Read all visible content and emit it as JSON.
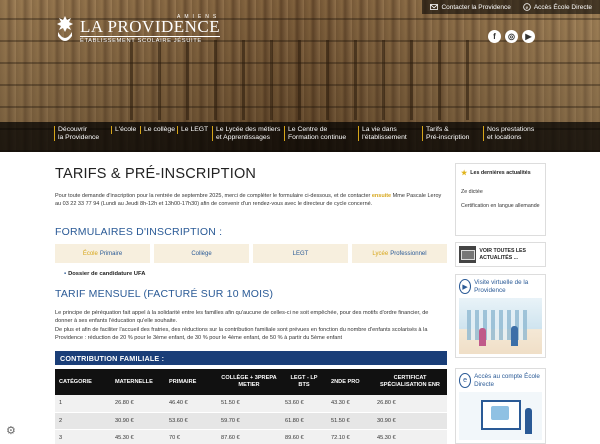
{
  "topbar": {
    "contact": "Contacter la Providence",
    "ecole_directe": "Accès École Directe"
  },
  "logo": {
    "city": "AMIENS",
    "name": "LA PROVIDENCE",
    "subtitle": "ÉTABLISSEMENT SCOLAIRE JÉSUITE"
  },
  "social": [
    "f",
    "◎",
    "▶"
  ],
  "nav": [
    {
      "line1": "Découvrir",
      "line2": "la Providence"
    },
    {
      "line1": "L'école",
      "line2": ""
    },
    {
      "line1": "Le collège",
      "line2": ""
    },
    {
      "line1": "Le LEGT",
      "line2": ""
    },
    {
      "line1": "Le Lycée des métiers",
      "line2": "et Apprentissages"
    },
    {
      "line1": "Le Centre de",
      "line2": "Formation continue"
    },
    {
      "line1": "La vie dans",
      "line2": "l'établissement"
    },
    {
      "line1": "Tarifs &",
      "line2": "Pré-inscription"
    },
    {
      "line1": "Nos prestations",
      "line2": "et locations"
    }
  ],
  "page": {
    "title": "TARIFS & PRÉ-INSCRIPTION",
    "intro_before": "Pour toute demande d'inscription pour la rentrée de septembre 2025, merci de compléter le formulaire ci-dessous, et de contacter ",
    "intro_link": "ensuite",
    "intro_after": " Mme Pascale Leroy au 03 22 33 77 94 (Lundi au Jeudi 8h-12h et 13h00-17h30) afin de convenir d'un rendez-vous avec le directeur de cycle concerné.",
    "forms_heading": "FORMULAIRES D'INSCRIPTION :",
    "forms": [
      {
        "accent": "École",
        "label": "Primaire"
      },
      {
        "accent": "",
        "label": "Collège"
      },
      {
        "accent": "",
        "label": "LEGT"
      },
      {
        "accent": "Lycée",
        "label": "Professionnel"
      }
    ],
    "ufa_link": "Dossier de candidature UFA",
    "tarif_heading": "TARIF MENSUEL (FACTURÉ SUR 10 MOIS)",
    "para1": "Le principe de péréquation fait appel à la solidarité entre les familles afin qu'aucune de celles-ci ne soit empêchée, pour des motifs d'ordre financier, de donner à ses enfants l'éducation qu'elle souhaite.",
    "para2": "De plus et afin de faciliter l'accueil des fratries, des réductions sur la contribution familiale sont prévues en fonction du nombre d'enfants scolarisés à la Providence : réduction de 20 % pour le 3ème enfant, de 30 % pour le 4ème enfant, de 50 % à partir du 5ème enfant",
    "contrib_label": "CONTRIBUTION FAMILIALE :"
  },
  "table": {
    "headers": [
      "CATÉGORIE",
      "MATERNELLE",
      "PRIMAIRE",
      "COLLÈGE + 3PREPA METIER",
      "LEGT - LP BTS",
      "2NDE PRO",
      "CERTIFICAT SPÉCIALISATION ENR"
    ],
    "rows": [
      [
        "1",
        "26.80 €",
        "46.40 €",
        "51.50 €",
        "53.60 €",
        "43.30 €",
        "26.80 €"
      ],
      [
        "2",
        "30.90 €",
        "53.60 €",
        "59.70 €",
        "61.80 €",
        "51.50 €",
        "30.90 €"
      ],
      [
        "3",
        "45.30 €",
        "70 €",
        "87.60 €",
        "89.60 €",
        "72.10 €",
        "45.30 €"
      ]
    ]
  },
  "sidebar": {
    "news_title": "Les dernières actualités",
    "news_items": [
      "Ze dictée",
      "Certification en langue allemande"
    ],
    "all_news": "VOIR TOUTES LES ACTUALITÉS ...",
    "visite_title": "Visite virtuelle de la Providence",
    "ecole_title": "Accès au compte École Directe"
  },
  "colors": {
    "accent_gold": "#d7a61a",
    "link_blue": "#2a5a96",
    "banner_navy": "#1a3e78"
  }
}
